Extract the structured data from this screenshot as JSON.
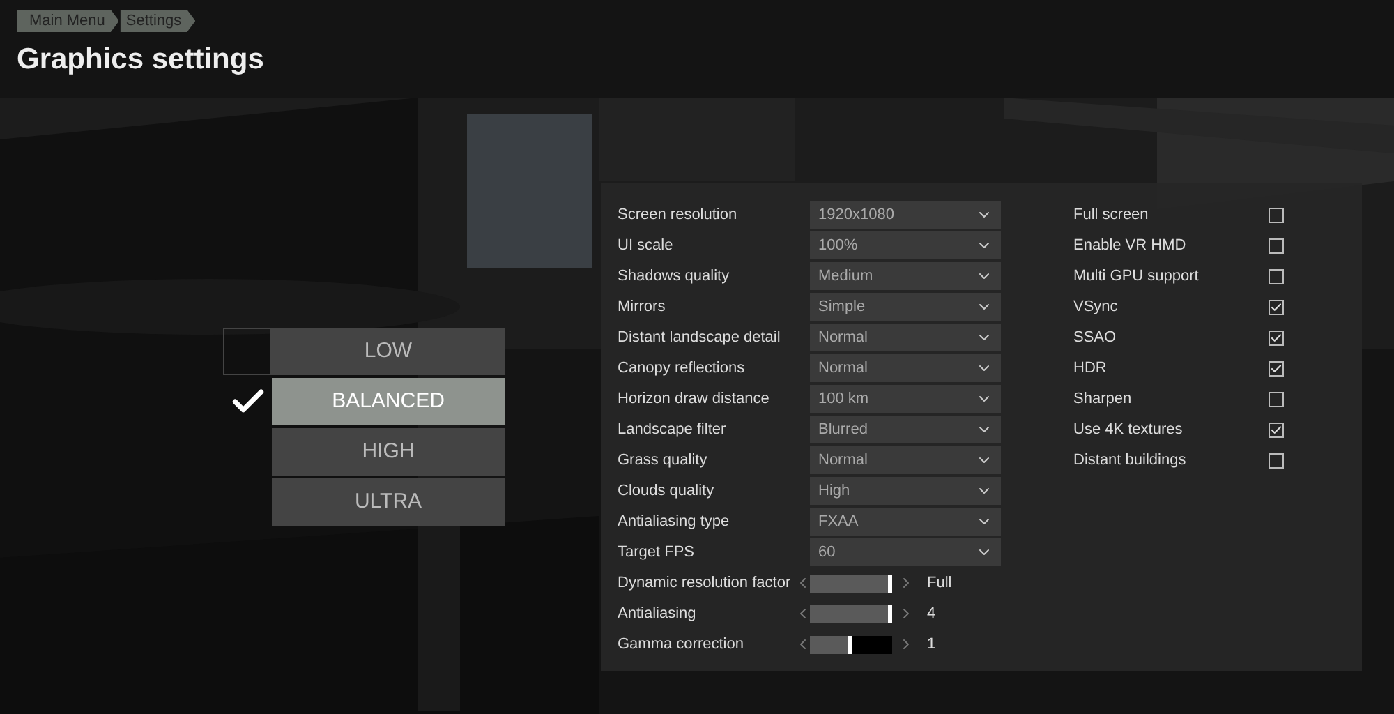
{
  "breadcrumb": [
    {
      "label": "Main Menu"
    },
    {
      "label": "Settings"
    }
  ],
  "title": "Graphics settings",
  "presets": [
    {
      "label": "LOW",
      "selected": false,
      "focused": true
    },
    {
      "label": "BALANCED",
      "selected": true,
      "focused": false
    },
    {
      "label": "HIGH",
      "selected": false,
      "focused": false
    },
    {
      "label": "ULTRA",
      "selected": false,
      "focused": false
    }
  ],
  "settings": [
    {
      "kind": "dropdown",
      "label": "Screen resolution",
      "value": "1920x1080"
    },
    {
      "kind": "dropdown",
      "label": "UI scale",
      "value": "100%"
    },
    {
      "kind": "dropdown",
      "label": "Shadows quality",
      "value": "Medium"
    },
    {
      "kind": "dropdown",
      "label": "Mirrors",
      "value": "Simple"
    },
    {
      "kind": "dropdown",
      "label": "Distant landscape detail",
      "value": "Normal"
    },
    {
      "kind": "dropdown",
      "label": "Canopy reflections",
      "value": "Normal"
    },
    {
      "kind": "dropdown",
      "label": "Horizon draw distance",
      "value": "100 km"
    },
    {
      "kind": "dropdown",
      "label": "Landscape filter",
      "value": "Blurred"
    },
    {
      "kind": "dropdown",
      "label": "Grass quality",
      "value": "Normal"
    },
    {
      "kind": "dropdown",
      "label": "Clouds quality",
      "value": "High"
    },
    {
      "kind": "dropdown",
      "label": "Antialiasing type",
      "value": "FXAA"
    },
    {
      "kind": "dropdown",
      "label": "Target FPS",
      "value": "60"
    },
    {
      "kind": "slider",
      "label": "Dynamic resolution factor",
      "level": 1.0,
      "reading": "Full"
    },
    {
      "kind": "slider",
      "label": "Antialiasing",
      "level": 1.0,
      "reading": "4"
    },
    {
      "kind": "slider",
      "label": "Gamma correction",
      "level": 0.5,
      "reading": "1"
    }
  ],
  "toggles": [
    {
      "label": "Full screen",
      "checked": false
    },
    {
      "label": "Enable VR HMD",
      "checked": false
    },
    {
      "label": "Multi GPU support",
      "checked": false
    },
    {
      "label": "VSync",
      "checked": true
    },
    {
      "label": "SSAO",
      "checked": true
    },
    {
      "label": "HDR",
      "checked": true
    },
    {
      "label": "Sharpen",
      "checked": false
    },
    {
      "label": "Use 4K textures",
      "checked": true
    },
    {
      "label": "Distant buildings",
      "checked": false
    }
  ]
}
